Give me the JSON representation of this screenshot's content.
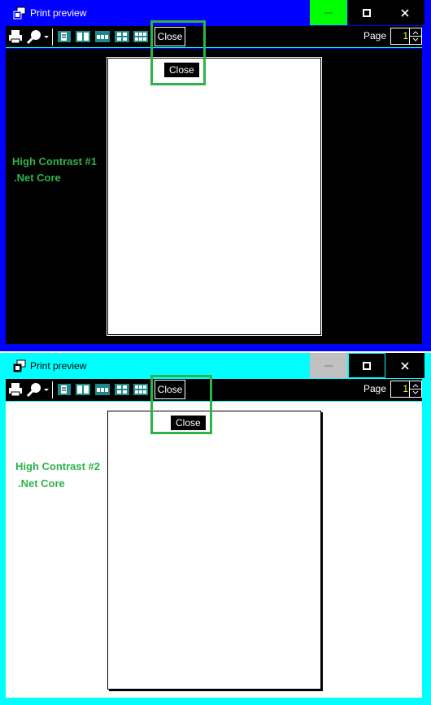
{
  "window1": {
    "title": "Print preview",
    "close_label": "Close",
    "tooltip": "Close",
    "page_label": "Page",
    "page_value": "1",
    "caption_line1": "High Contrast #1",
    "caption_line2": ".Net Core",
    "colors": {
      "frame": "#0000ff",
      "minimize_bg": "#00ff00",
      "client": "#000000",
      "caption": "#2db34a"
    }
  },
  "window2": {
    "title": "Print preview",
    "close_label": "Close",
    "tooltip": "Close",
    "page_label": "Page",
    "page_value": "1",
    "caption_line1": "High Contrast #2",
    "caption_line2": ".Net Core",
    "colors": {
      "frame": "#00ffff",
      "minimize_bg": "#c0c0c0",
      "client": "#ffffff",
      "caption": "#2db34a"
    }
  },
  "icons": [
    "app-icon",
    "print-icon",
    "zoom-icon",
    "dropdown-arrow-icon",
    "one-page-icon",
    "two-pages-icon",
    "three-pages-icon",
    "four-pages-icon",
    "six-pages-icon",
    "minimize-icon",
    "maximize-icon",
    "close-icon",
    "spin-up-icon",
    "spin-down-icon"
  ]
}
